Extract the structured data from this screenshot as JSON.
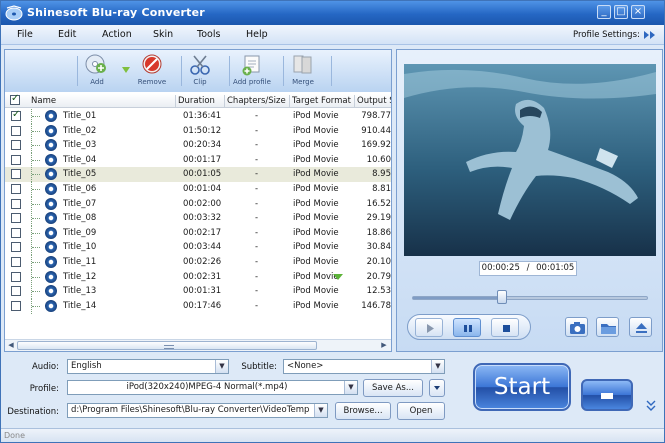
{
  "window": {
    "title": "Shinesoft Blu-ray Converter",
    "min": "_",
    "max": "□",
    "close": "×"
  },
  "menu": {
    "items": [
      "File",
      "Edit",
      "Action",
      "Skin",
      "Tools",
      "Help"
    ],
    "profile_settings": "Profile Settings:"
  },
  "toolbar": {
    "add": "Add",
    "remove": "Remove",
    "clip": "Clip",
    "add_profile": "Add profile",
    "merge": "Merge"
  },
  "table": {
    "headers": [
      "Name",
      "Duration",
      "Chapters/Size",
      "Target Format",
      "Output Si"
    ],
    "rows": [
      {
        "name": "Title_01",
        "duration": "01:36:41",
        "chapters": "-",
        "format": "iPod Movie",
        "size": "798.77",
        "checked": true
      },
      {
        "name": "Title_02",
        "duration": "01:50:12",
        "chapters": "-",
        "format": "iPod Movie",
        "size": "910.44",
        "checked": false
      },
      {
        "name": "Title_03",
        "duration": "00:20:34",
        "chapters": "-",
        "format": "iPod Movie",
        "size": "169.92",
        "checked": false
      },
      {
        "name": "Title_04",
        "duration": "00:01:17",
        "chapters": "-",
        "format": "iPod Movie",
        "size": "10.60",
        "checked": false
      },
      {
        "name": "Title_05",
        "duration": "00:01:05",
        "chapters": "-",
        "format": "iPod Movie",
        "size": "8.95",
        "checked": false
      },
      {
        "name": "Title_06",
        "duration": "00:01:04",
        "chapters": "-",
        "format": "iPod Movie",
        "size": "8.81",
        "checked": false
      },
      {
        "name": "Title_07",
        "duration": "00:02:00",
        "chapters": "-",
        "format": "iPod Movie",
        "size": "16.52",
        "checked": false
      },
      {
        "name": "Title_08",
        "duration": "00:03:32",
        "chapters": "-",
        "format": "iPod Movie",
        "size": "29.19",
        "checked": false
      },
      {
        "name": "Title_09",
        "duration": "00:02:17",
        "chapters": "-",
        "format": "iPod Movie",
        "size": "18.86",
        "checked": false
      },
      {
        "name": "Title_10",
        "duration": "00:03:44",
        "chapters": "-",
        "format": "iPod Movie",
        "size": "30.84",
        "checked": false
      },
      {
        "name": "Title_11",
        "duration": "00:02:26",
        "chapters": "-",
        "format": "iPod Movie",
        "size": "20.10",
        "checked": false
      },
      {
        "name": "Title_12",
        "duration": "00:02:31",
        "chapters": "-",
        "format": "iPod Movie",
        "size": "20.79",
        "checked": false
      },
      {
        "name": "Title_13",
        "duration": "00:01:31",
        "chapters": "-",
        "format": "iPod Movie",
        "size": "12.53",
        "checked": false
      },
      {
        "name": "Title_14",
        "duration": "00:17:46",
        "chapters": "-",
        "format": "iPod Movie",
        "size": "146.78",
        "checked": false
      }
    ],
    "selected_index": 4
  },
  "preview": {
    "current_time": "00:00:25",
    "separator": "/",
    "total_time": "00:01:05",
    "progress": 0.38
  },
  "form": {
    "audio_label": "Audio:",
    "audio_value": "English",
    "subtitle_label": "Subtitle:",
    "subtitle_value": "<None>",
    "profile_label": "Profile:",
    "profile_value": "iPod(320x240)MPEG-4 Normal(*.mp4)",
    "save_as": "Save As...",
    "destination_label": "Destination:",
    "destination_value": "d:\\Program Files\\Shinesoft\\Blu-ray Converter\\VideoTemp",
    "browse": "Browse...",
    "open": "Open"
  },
  "actions": {
    "start": "Start"
  },
  "status": {
    "text": "Done"
  }
}
